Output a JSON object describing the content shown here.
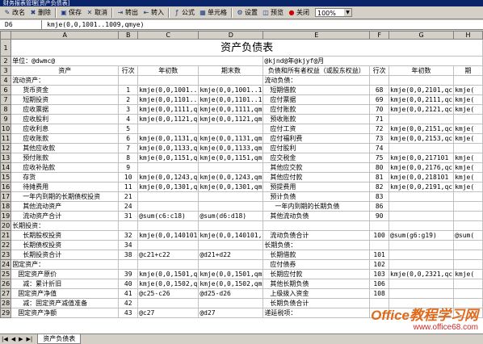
{
  "window": {
    "title": "财务报表管理[资产负债表]"
  },
  "toolbar": {
    "buttons": [
      {
        "label": "改名",
        "icon": "rename-icon"
      },
      {
        "label": "删除",
        "icon": "delete-icon"
      },
      {
        "label": "保存",
        "icon": "save-icon"
      },
      {
        "label": "取消",
        "icon": "cancel-icon"
      },
      {
        "label": "转出",
        "icon": "export-icon"
      },
      {
        "label": "转入",
        "icon": "import-icon"
      },
      {
        "label": "公式",
        "icon": "formula-icon"
      },
      {
        "label": "单元格",
        "icon": "cell-icon"
      },
      {
        "label": "设置",
        "icon": "settings-icon"
      },
      {
        "label": "预览",
        "icon": "preview-icon"
      },
      {
        "label": "关闭",
        "icon": "close-icon"
      }
    ],
    "zoom": "100%"
  },
  "formula_bar": {
    "cell_ref": "D6",
    "formula": "kmje(0,0,1001..1009,qmye)"
  },
  "sheet": {
    "columns": [
      "A",
      "B",
      "C",
      "D",
      "E",
      "F",
      "G",
      "H"
    ],
    "title": "资产负债表",
    "unit_label": "单位：@dwmc@",
    "date_label": "@kjnd@年@kjyf@月",
    "headers": [
      "资产",
      "行次",
      "年初数",
      "期末数",
      "负债和所有者权益（或股东权益）",
      "行次",
      "年初数",
      "期"
    ],
    "rows": [
      {
        "n": "4",
        "a": "流动资产：",
        "b": "",
        "c": "",
        "d": "",
        "e": "流动负债：",
        "f": "",
        "g": "",
        "h": "",
        "ia": 0,
        "ie": 0
      },
      {
        "n": "6",
        "a": "货币资金",
        "b": "1",
        "c": "kmje(0,0,1001..",
        "d": "kmje(0,0,1001..1",
        "e": "短期借款",
        "f": "68",
        "g": "kmje(0,0,2101,qc",
        "h": "kmje(",
        "ia": 2,
        "ie": 1
      },
      {
        "n": "7",
        "a": "短期投资",
        "b": "2",
        "c": "kmje(0,0,1101..",
        "d": "kmje(0,0,1101..1",
        "e": "应付票据",
        "f": "69",
        "g": "kmje(0,0,2111,qc",
        "h": "kmje(",
        "ia": 2,
        "ie": 1
      },
      {
        "n": "8",
        "a": "应收票据",
        "b": "3",
        "c": "kmje(0,0,1111,q",
        "d": "kmje(0,0,1111,qm",
        "e": "应付账款",
        "f": "70",
        "g": "kmje(0,0,2121,qc",
        "h": "kmje(",
        "ia": 2,
        "ie": 1
      },
      {
        "n": "9",
        "a": "应收股利",
        "b": "4",
        "c": "kmje(0,0,1121,q",
        "d": "kmje(0,0,1121,qm",
        "e": "预收账款",
        "f": "71",
        "g": "",
        "h": "",
        "ia": 2,
        "ie": 1
      },
      {
        "n": "10",
        "a": "应收利息",
        "b": "5",
        "c": "",
        "d": "",
        "e": "应付工资",
        "f": "72",
        "g": "kmje(0,0,2151,qc",
        "h": "kmje(",
        "ia": 2,
        "ie": 1
      },
      {
        "n": "11",
        "a": "应收账款",
        "b": "6",
        "c": "kmje(0,0,1131,q",
        "d": "kmje(0,0,1131,qm",
        "e": "应付福利费",
        "f": "73",
        "g": "kmje(0,0,2153,qc",
        "h": "kmje(",
        "ia": 2,
        "ie": 1
      },
      {
        "n": "12",
        "a": "其他应收款",
        "b": "7",
        "c": "kmje(0,0,1133,q",
        "d": "kmje(0,0,1133,qm",
        "e": "应付股利",
        "f": "74",
        "g": "",
        "h": "",
        "ia": 2,
        "ie": 1
      },
      {
        "n": "13",
        "a": "预付账款",
        "b": "8",
        "c": "kmje(0,0,1151,q",
        "d": "kmje(0,0,1151,qm",
        "e": "应交税金",
        "f": "75",
        "g": "kmje(0,0,217101",
        "h": "kmje(",
        "ia": 2,
        "ie": 1
      },
      {
        "n": "14",
        "a": "应收补贴款",
        "b": "9",
        "c": "",
        "d": "",
        "e": "其他应交款",
        "f": "80",
        "g": "kmje(0,0,2176,qc",
        "h": "kmje(",
        "ia": 2,
        "ie": 1
      },
      {
        "n": "15",
        "a": "存货",
        "b": "10",
        "c": "kmje(0,0,1243,q",
        "d": "kmje(0,0,1243,qm",
        "e": "其他应付款",
        "f": "81",
        "g": "kmje(0,0,218101",
        "h": "kmje(",
        "ia": 2,
        "ie": 1
      },
      {
        "n": "16",
        "a": "待摊费用",
        "b": "11",
        "c": "kmje(0,0,1301,q",
        "d": "kmje(0,0,1301,qm",
        "e": "预提费用",
        "f": "82",
        "g": "kmje(0,0,2191,qc",
        "h": "kmje(",
        "ia": 2,
        "ie": 1
      },
      {
        "n": "17",
        "a": "一年内到期的长期债权投资",
        "b": "21",
        "c": "",
        "d": "",
        "e": "预计负债",
        "f": "83",
        "g": "",
        "h": "",
        "ia": 2,
        "ie": 1
      },
      {
        "n": "18",
        "a": "其他流动资产",
        "b": "24",
        "c": "",
        "d": "",
        "e": "一年内到期的长期负债",
        "f": "86",
        "g": "",
        "h": "",
        "ia": 2,
        "ie": 2
      },
      {
        "n": "19",
        "a": "流动资产合计",
        "b": "31",
        "c": "@sum(c6:c18)",
        "d": "@sum(d6:d18)",
        "e": "其他流动负债",
        "f": "90",
        "g": "",
        "h": "",
        "ia": 2,
        "ie": 1
      },
      {
        "n": "20",
        "a": "长期投资：",
        "b": "",
        "c": "",
        "d": "",
        "e": "",
        "f": "",
        "g": "",
        "h": "",
        "ia": 0,
        "ie": 0
      },
      {
        "n": "21",
        "a": "长期股权投资",
        "b": "32",
        "c": "kmje(0,0,140101",
        "d": "kmje(0,0,140101,",
        "e": "流动负债合计",
        "f": "100",
        "g": "@sum(g6:g19)",
        "h": "@sum(",
        "ia": 2,
        "ie": 1
      },
      {
        "n": "22",
        "a": "长期债权投资",
        "b": "34",
        "c": "",
        "d": "",
        "e": "长期负债：",
        "f": "",
        "g": "",
        "h": "",
        "ia": 2,
        "ie": 0
      },
      {
        "n": "23",
        "a": "长期投资合计",
        "b": "38",
        "c": "@c21+c22",
        "d": "@d21+d22",
        "e": "长期借款",
        "f": "101",
        "g": "",
        "h": "",
        "ia": 2,
        "ie": 1
      },
      {
        "n": "24",
        "a": "固定资产：",
        "b": "",
        "c": "",
        "d": "",
        "e": "应付债券",
        "f": "102",
        "g": "",
        "h": "",
        "ia": 0,
        "ie": 1
      },
      {
        "n": "25",
        "a": "固定资产原价",
        "b": "39",
        "c": "kmje(0,0,1501,q",
        "d": "kmje(0,0,1501,qm",
        "e": "长期应付款",
        "f": "103",
        "g": "kmje(0,0,2321,qc",
        "h": "kmje(",
        "ia": 1,
        "ie": 1
      },
      {
        "n": "26",
        "a": "减：累计折旧",
        "b": "40",
        "c": "kmje(0,0,1502,q",
        "d": "kmje(0,0,1502,qm",
        "e": "其他长期负债",
        "f": "106",
        "g": "",
        "h": "",
        "ia": 2,
        "ie": 1
      },
      {
        "n": "27",
        "a": "固定资产净值",
        "b": "41",
        "c": "@c25-c26",
        "d": "@d25-d26",
        "e": "上级拨入资金",
        "f": "108",
        "g": "",
        "h": "",
        "ia": 1,
        "ie": 1
      },
      {
        "n": "28",
        "a": "减：固定资产减值准备",
        "b": "42",
        "c": "",
        "d": "",
        "e": "长期负债合计",
        "f": "",
        "g": "",
        "h": "",
        "ia": 2,
        "ie": 1
      },
      {
        "n": "29",
        "a": "固定资产净额",
        "b": "43",
        "c": "@c27",
        "d": "@d27",
        "e": "递延税项：",
        "f": "",
        "g": "",
        "h": "",
        "ia": 1,
        "ie": 0
      }
    ]
  },
  "sheet_tabs": [
    "资产负债表"
  ],
  "watermark": {
    "main": "Office教程学习网",
    "url": "www.office68.com"
  }
}
